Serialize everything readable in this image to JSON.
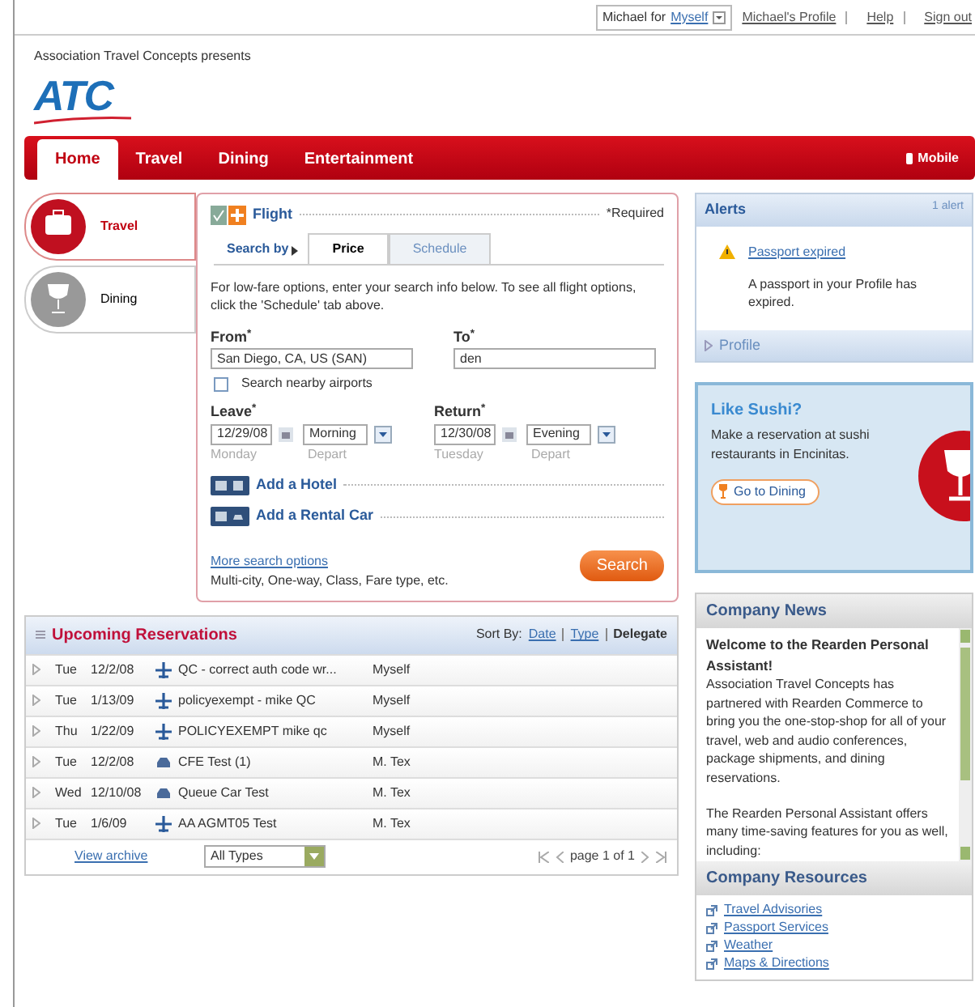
{
  "top_bar": {
    "user": "Michael for",
    "delegate": "Myself",
    "links": [
      "Michael's Profile",
      "Help",
      "Sign out"
    ]
  },
  "header": {
    "presenter": "Association Travel Concepts presents",
    "logo": "ATC"
  },
  "nav": {
    "tabs": [
      {
        "label": "Home",
        "selected": true
      },
      {
        "label": "Travel",
        "selected": false
      },
      {
        "label": "Dining",
        "selected": false
      },
      {
        "label": "Entertainment",
        "selected": false
      }
    ],
    "mobile": "Mobile"
  },
  "categories": [
    {
      "label": "Travel",
      "kind": "travel",
      "selected": true
    },
    {
      "label": "Dining",
      "kind": "dining",
      "selected": false
    }
  ],
  "flight": {
    "title": "Flight",
    "required": "*Required",
    "search_by": "Search by",
    "tabs": [
      {
        "label": "Price",
        "selected": true
      },
      {
        "label": "Schedule",
        "selected": false
      }
    ],
    "intro": "For low-fare options, enter your search info below. To see all flight options, click the 'Schedule' tab above.",
    "from": {
      "label": "From$^{*}$",
      "value": "San Diego, CA, US (SAN)"
    },
    "to": {
      "label": "To$^{*}$",
      "value": "den"
    },
    "nearby": {
      "label": "Search nearby airports",
      "checked": false
    },
    "leave": {
      "label": "Leave$^{*}$",
      "date": "12/29/08",
      "day": "Monday",
      "time": "Morning",
      "time_caption": "Depart"
    },
    "return": {
      "label": "Return$^{*}$",
      "date": "12/30/08",
      "day": "Tuesday",
      "time": "Evening",
      "time_caption": "Depart"
    },
    "add_ons": [
      {
        "label": "Add a Hotel",
        "kind": "hotel"
      },
      {
        "label": "Add a Rental Car",
        "kind": "car"
      }
    ],
    "more_link": "More search options",
    "more_note": "Multi-city, One-way, Class, Fare type, etc.",
    "search_button": "Search"
  },
  "reservations": {
    "title": "Upcoming Reservations",
    "sort_label": "Sort By:",
    "sort_links": [
      "Date",
      "Type"
    ],
    "delegate": "Delegate",
    "rows": [
      {
        "day": "Tue",
        "date": "12/2/08",
        "kind": "flight",
        "title": "QC - correct auth code wr...",
        "traveler": "Myself"
      },
      {
        "day": "Tue",
        "date": "1/13/09",
        "kind": "flight",
        "title": "policyexempt - mike QC",
        "traveler": "Myself"
      },
      {
        "day": "Thu",
        "date": "1/22/09",
        "kind": "flight",
        "title": "POLICYEXEMPT mike qc",
        "traveler": "Myself"
      },
      {
        "day": "Tue",
        "date": "12/2/08",
        "kind": "car",
        "title": "CFE Test (1)",
        "traveler": "M. Tex"
      },
      {
        "day": "Wed",
        "date": "12/10/08",
        "kind": "car",
        "title": "Queue Car Test",
        "traveler": "M. Tex"
      },
      {
        "day": "Tue",
        "date": "1/6/09",
        "kind": "flight",
        "title": "AA AGMT05 Test",
        "traveler": "M. Tex"
      }
    ],
    "archive_link": "View archive",
    "type_filter": "All Types",
    "pager": "page 1 of 1"
  },
  "alerts": {
    "title": "Alerts",
    "count": "1 alert",
    "link": "Passport expired",
    "message": "A passport in your Profile has expired.",
    "profile": "Profile"
  },
  "promo": {
    "title": "Like Sushi?",
    "text": "Make a reservation at sushi restaurants in Encinitas.",
    "button": "Go to Dining"
  },
  "news": {
    "title": "Company News",
    "headline": "Welcome to the Rearden Personal Assistant!",
    "paragraphs": [
      "Association Travel Concepts has partnered with Rearden Commerce to bring you the one-stop-shop for all of your travel, web and audio conferences, package shipments, and dining reservations.",
      "The Rearden Personal Assistant offers many time-saving features for you as well, including:"
    ]
  },
  "resources": {
    "title": "Company Resources",
    "links": [
      "Travel Advisories",
      "Passport Services",
      "Weather",
      "Maps & Directions"
    ]
  }
}
